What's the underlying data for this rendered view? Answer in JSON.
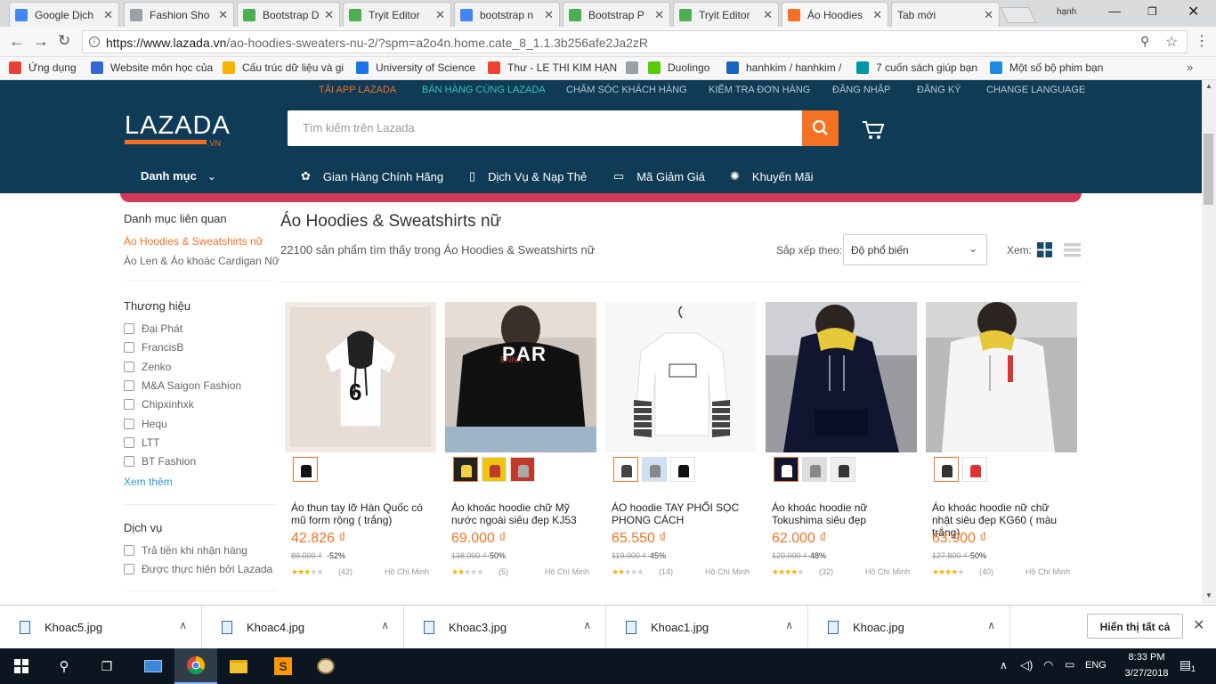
{
  "browser": {
    "tabs": [
      {
        "title": "Google Dịch",
        "icon": "google-icon",
        "color": "#4285f4"
      },
      {
        "title": "Fashion Sho",
        "icon": "page-icon",
        "color": "#9aa0a6"
      },
      {
        "title": "Bootstrap D",
        "icon": "w3-icon",
        "color": "#4caf50"
      },
      {
        "title": "Tryit Editor",
        "icon": "w3-icon",
        "color": "#4caf50"
      },
      {
        "title": "bootstrap n",
        "icon": "google-icon",
        "color": "#4285f4"
      },
      {
        "title": "Bootstrap P",
        "icon": "w3-icon",
        "color": "#4caf50"
      },
      {
        "title": "Tryit Editor",
        "icon": "w3-icon",
        "color": "#4caf50"
      },
      {
        "title": "Áo Hoodies",
        "icon": "lazada-icon",
        "color": "#f36f21"
      },
      {
        "title": "Tab mới",
        "icon": "none",
        "color": "#f2f2f2"
      }
    ],
    "profile_name": "hạnh",
    "url_host": "https://www.lazada.vn",
    "url_path": "/ao-hoodies-sweaters-nu-2/?spm=a2o4n.home.cate_8_1.1.3b256afe2Ja2zR",
    "bookmarks": [
      {
        "label": "Ứng dụng",
        "color": "#e94235"
      },
      {
        "label": "Website môn học của",
        "color": "#3367d6"
      },
      {
        "label": "Cấu trúc dữ liệu và gi",
        "color": "#f4b400"
      },
      {
        "label": "University of Science",
        "color": "#1a73e8"
      },
      {
        "label": "Thư - LE THI KIM HẠN",
        "color": "#ea4335"
      },
      {
        "label": "",
        "color": "#9aa0a6"
      },
      {
        "label": "Duolingo",
        "color": "#58cc02"
      },
      {
        "label": "hanhkim / hanhkim /",
        "color": "#1565c0"
      },
      {
        "label": "7 cuốn sách giúp bạn",
        "color": "#0097a7"
      },
      {
        "label": "Một số bộ phim bạn",
        "color": "#1e88e5"
      }
    ]
  },
  "header": {
    "top_links": [
      "TẢI APP LAZADA",
      "BÁN HÀNG CÙNG LAZADA",
      "CHĂM SÓC KHÁCH HÀNG",
      "KIỂM TRA ĐƠN HÀNG",
      "ĐĂNG NHẬP",
      "ĐĂNG KÝ",
      "CHANGE LANGUAGE"
    ],
    "logo": "LAZADA",
    "logo_suffix": ".VN",
    "search_placeholder": "Tìm kiếm trên Lazada",
    "category_label": "Danh mục",
    "nav": [
      "Gian Hàng Chính Hãng",
      "Dịch Vụ & Nạp Thẻ",
      "Mã Giảm Giá",
      "Khuyến Mãi"
    ],
    "colors": {
      "bar": "#0f3b56",
      "accent": "#f57224",
      "highlight": "#f36f21"
    }
  },
  "sidebar": {
    "related_title": "Danh mục liên quan",
    "related": [
      "Áo Hoodies & Sweatshirts nữ",
      "Áo Len & Áo khoác Cardigan Nữ"
    ],
    "brand_title": "Thương hiệu",
    "brands": [
      "Đại Phát",
      "FrancisB",
      "Zenko",
      "M&A Saigon Fashion",
      "Chipxinhxk",
      "Hequ",
      "LTT",
      "BT Fashion"
    ],
    "more": "Xem thêm",
    "service_title": "Dịch vụ",
    "services": [
      "Trả tiền khi nhận hàng",
      "Được thực hiện bởi Lazada"
    ]
  },
  "main": {
    "title": "Áo Hoodies & Sweatshirts nữ",
    "count": "22100 sản phẩm tìm thấy trong Áo Hoodies & Sweatshirts nữ",
    "sort_label": "Sắp xếp theo:",
    "sort_value": "Độ phổ biến",
    "view_label": "Xem:"
  },
  "products": [
    {
      "name": "Áo thun tay lỡ Hàn Quốc có mũ form rộng ( trắng)",
      "price": "42.826 ₫",
      "old": "89.000 ₫",
      "discount": "-52%",
      "rating": 2.5,
      "reviews": "(42)",
      "location": "Hồ Chí Minh"
    },
    {
      "name": "Áo khoác hoodie chữ Mỹ nước ngoài siêu đẹp KJ53",
      "price": "69.000 ₫",
      "old": "138.000 ₫",
      "discount": "-50%",
      "rating": 2,
      "reviews": "(5)",
      "location": "Hồ Chí Minh"
    },
    {
      "name": "ÁO hoodie TAY PHỐI SỌC PHONG CÁCH",
      "price": "65.550 ₫",
      "old": "119.000 ₫",
      "discount": "-45%",
      "rating": 1.5,
      "reviews": "(14)",
      "location": "Hồ Chí Minh"
    },
    {
      "name": "Áo khoác hoodie nữ Tokushima siêu đẹp",
      "price": "62.000 ₫",
      "old": "120.000 ₫",
      "discount": "-48%",
      "rating": 4,
      "reviews": "(32)",
      "location": "Hồ Chí Minh"
    },
    {
      "name": "Áo khoác hoodie nữ chữ nhật siêu đẹp KG60 ( màu trắng)",
      "price": "63.900 ₫",
      "old": "127.800 ₫",
      "discount": "-50%",
      "rating": 4,
      "reviews": "(40)",
      "location": "Hồ Chí Minh"
    }
  ],
  "downloads": {
    "files": [
      "Khoac5.jpg",
      "Khoac4.jpg",
      "Khoac3.jpg",
      "Khoac1.jpg",
      "Khoac.jpg"
    ],
    "show_all": "Hiển thị tất cả"
  },
  "taskbar": {
    "lang": "ENG",
    "time": "8:33 PM",
    "date": "3/27/2018",
    "notif": "1"
  }
}
